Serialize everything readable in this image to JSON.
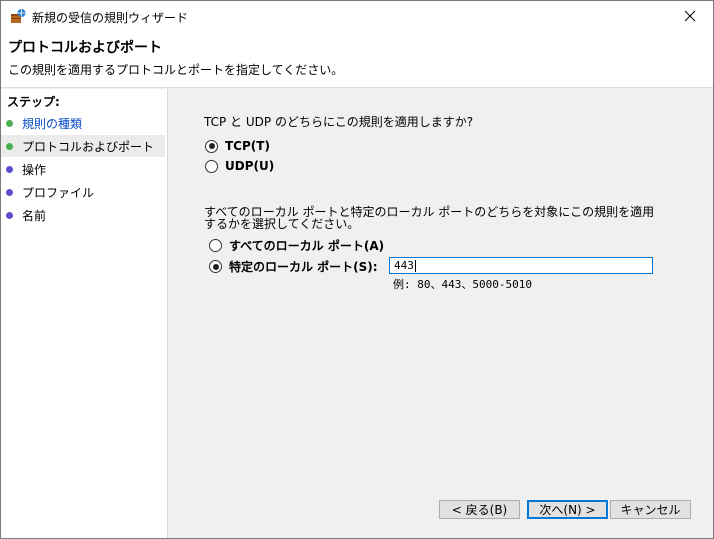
{
  "window": {
    "title": "新規の受信の規則ウィザード"
  },
  "header": {
    "title": "プロトコルおよびポート",
    "subtitle": "この規則を適用するプロトコルとポートを指定してください。"
  },
  "sidebar": {
    "steps_label": "ステップ:",
    "items": [
      {
        "label": "規則の種類",
        "dot_color": "#4caf50",
        "state": "completed"
      },
      {
        "label": "プロトコルおよびポート",
        "dot_color": "#4caf50",
        "state": "current"
      },
      {
        "label": "操作",
        "dot_color": "#5b4fd0",
        "state": "pending"
      },
      {
        "label": "プロファイル",
        "dot_color": "#5b4fd0",
        "state": "pending"
      },
      {
        "label": "名前",
        "dot_color": "#5b4fd0",
        "state": "pending"
      }
    ]
  },
  "main": {
    "protocol_question": "TCP と UDP のどちらにこの規則を適用しますか?",
    "protocol_options": [
      {
        "label": "TCP(T)",
        "checked": true
      },
      {
        "label": "UDP(U)",
        "checked": false
      }
    ],
    "ports_question": "すべてのローカル ポートと特定のローカル ポートのどちらを対象にこの規則を適用するかを選択してください。",
    "port_options": [
      {
        "label": "すべてのローカル ポート(A)",
        "checked": false
      },
      {
        "label": "特定のローカル ポート(S):",
        "checked": true
      }
    ],
    "port_value": "443",
    "example": "例: 80、443、5000-5010"
  },
  "buttons": {
    "back": "< 戻る(B)",
    "next": "次へ(N) >",
    "cancel": "キャンセル"
  },
  "colors": {
    "accent": "#0078d7",
    "current_step_text": "#0b4cc9",
    "completed_dot": "#4caf50",
    "pending_dot": "#5b4fd0"
  }
}
